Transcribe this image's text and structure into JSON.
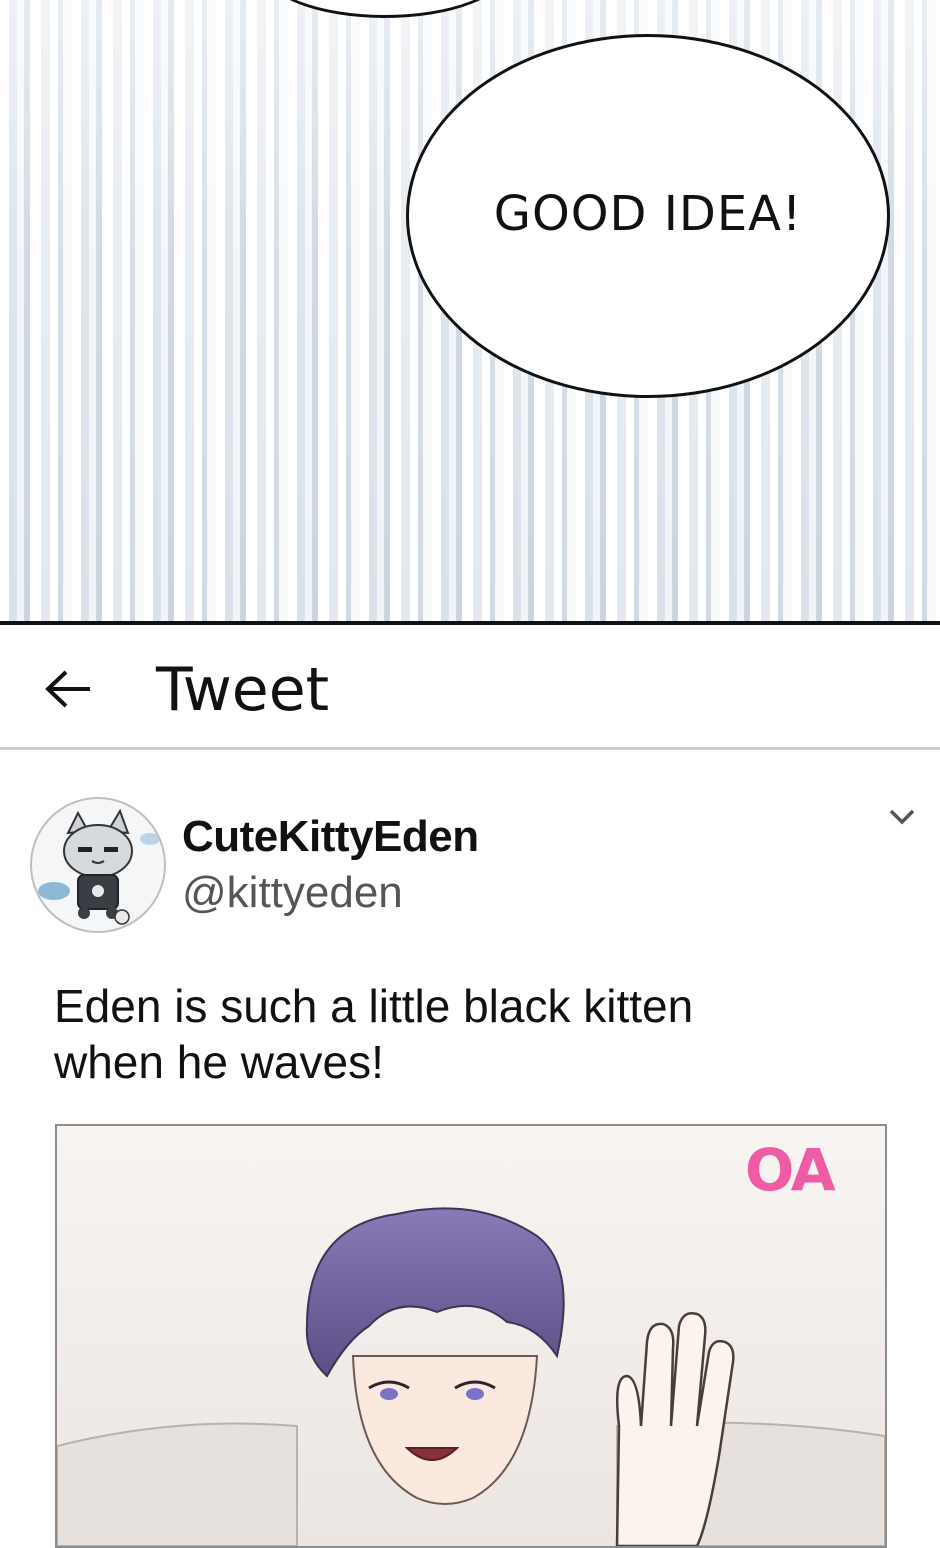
{
  "panel": {
    "bubble_text": "GOOD IDEA!"
  },
  "header": {
    "back_icon": "arrow-left-icon",
    "title": "Tweet"
  },
  "tweet": {
    "display_name": "CuteKittyEden",
    "handle": "@kittyeden",
    "menu_icon": "chevron-down-icon",
    "text_lines": [
      "Eden is such a little black kitten",
      "when he waves!"
    ],
    "watermark": "OA"
  },
  "colors": {
    "text": "#111111",
    "handle": "#555555",
    "divider": "#cfcfcf",
    "watermark": "#f05ba6",
    "stripe": "#d9e1ea"
  }
}
